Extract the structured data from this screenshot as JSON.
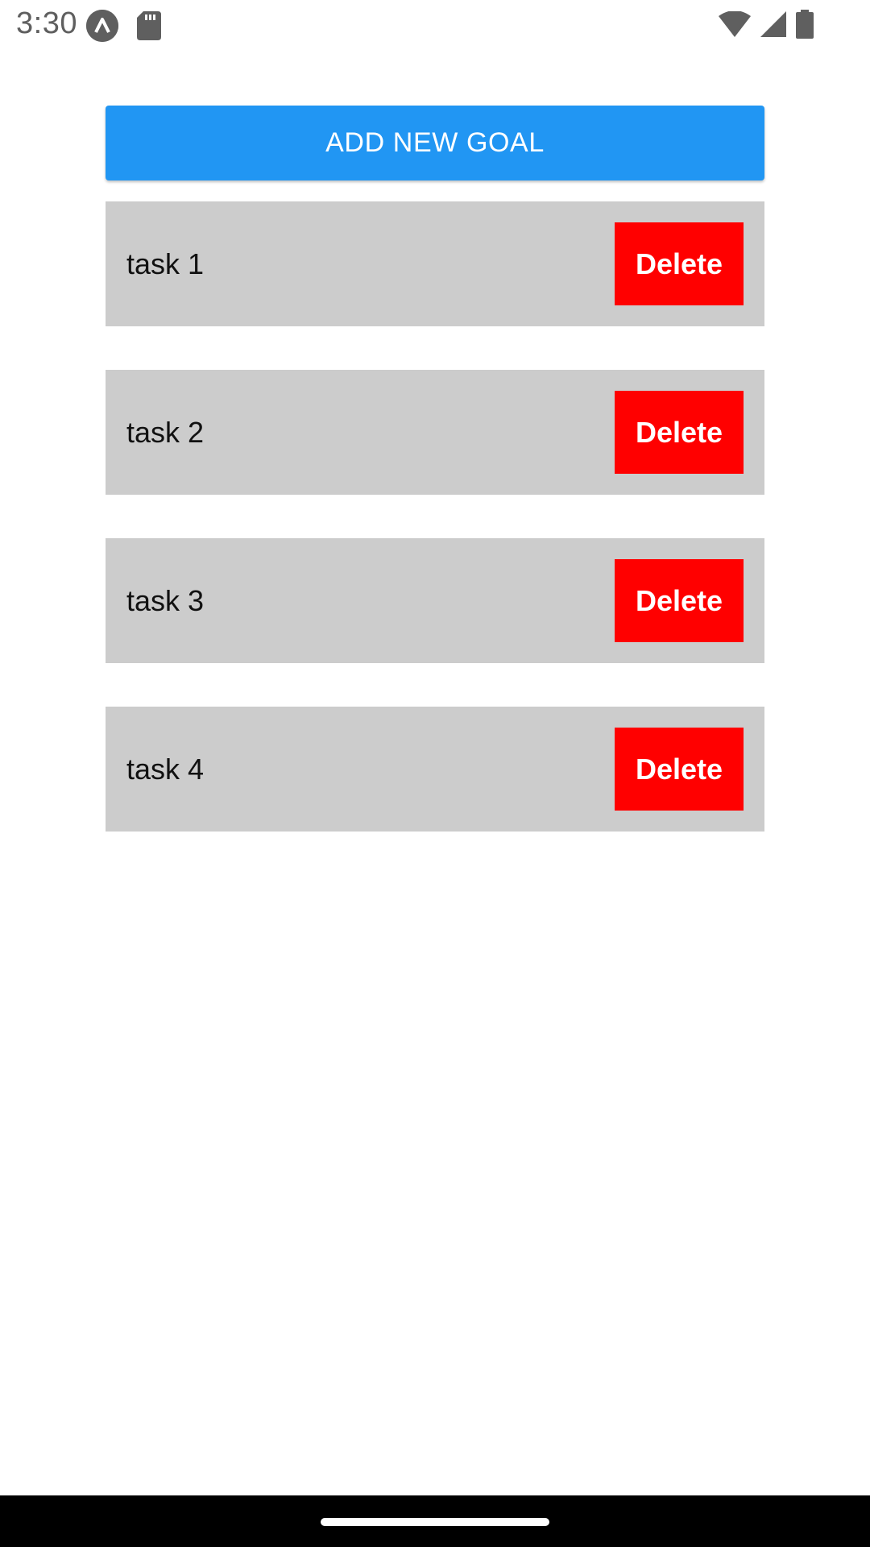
{
  "status_bar": {
    "time": "3:30",
    "icons": [
      "app-notification-icon",
      "sd-card-icon",
      "wifi-icon",
      "cellular-signal-icon",
      "battery-icon"
    ],
    "icon_color": "#5f5f5f"
  },
  "main": {
    "add_button_label": "ADD NEW GOAL",
    "accent_color": "#2196f3",
    "goals": [
      {
        "label": "task 1",
        "delete_label": "Delete"
      },
      {
        "label": "task 2",
        "delete_label": "Delete"
      },
      {
        "label": "task 3",
        "delete_label": "Delete"
      },
      {
        "label": "task 4",
        "delete_label": "Delete"
      }
    ],
    "item_background": "#cccccc",
    "delete_color": "#ff0000"
  }
}
